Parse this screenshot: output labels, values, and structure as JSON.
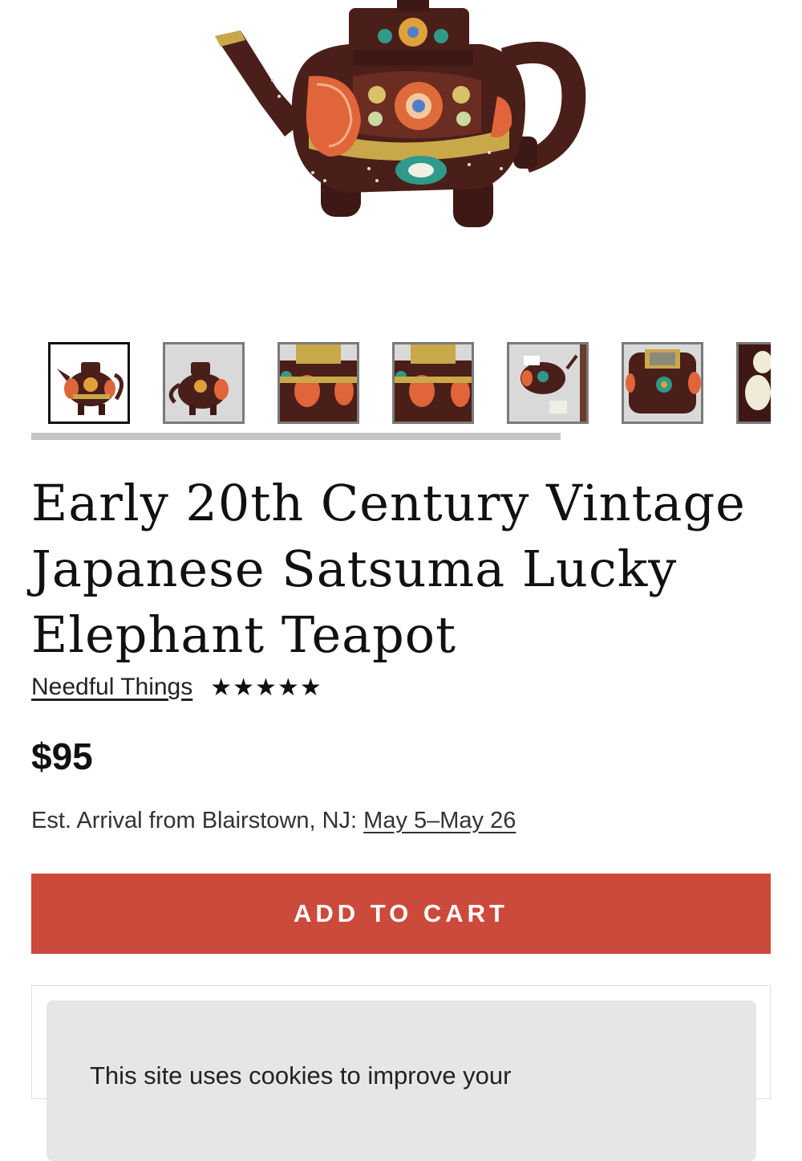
{
  "product": {
    "title": "Early 20th Century Vintage Japanese Satsuma Lucky Elephant Teapot",
    "seller": "Needful Things",
    "rating_stars": "★★★★★",
    "rating": 5,
    "price": "$95",
    "arrival_prefix": "Est. Arrival from Blairstown, NJ: ",
    "arrival_dates": "May 5–May 26"
  },
  "gallery": {
    "thumbnail_count_visible": 7,
    "active_index": 0
  },
  "cart": {
    "add_label": "ADD TO CART",
    "button_color": "#cc4a3b"
  },
  "cookie": {
    "text": "This site uses cookies to improve your"
  },
  "colors": {
    "teapot_body": "#4a1f1a",
    "accent_orange": "#e0653a",
    "accent_gold": "#c9a84a",
    "accent_teal": "#2f9a8a"
  }
}
